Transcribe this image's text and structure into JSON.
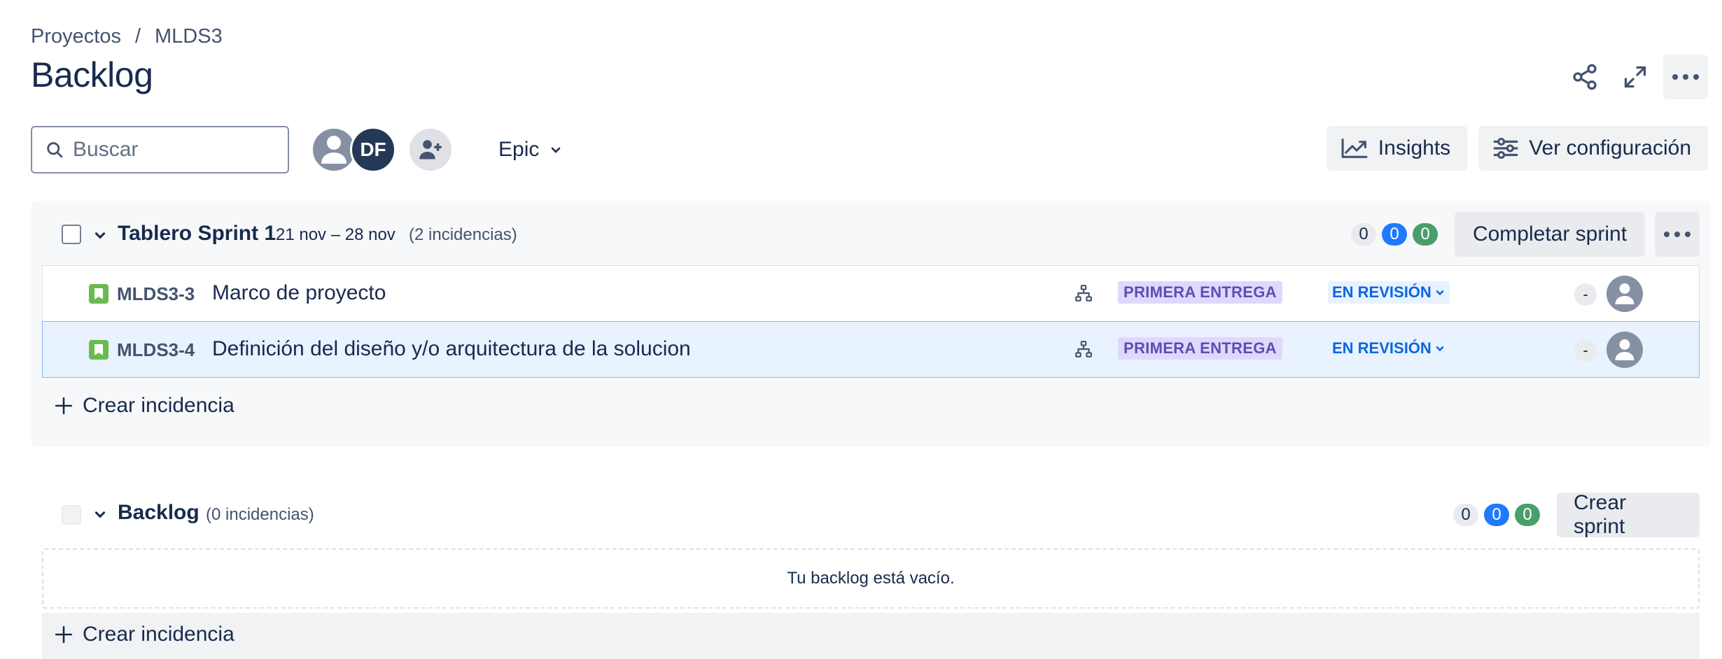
{
  "breadcrumb": {
    "items": [
      "Proyectos",
      "MLDS3"
    ],
    "separator": "/"
  },
  "page_title": "Backlog",
  "toolbar": {
    "search_placeholder": "Buscar",
    "avatar_initials": "DF",
    "epic_filter_label": "Epic",
    "insights_label": "Insights",
    "settings_label": "Ver configuración"
  },
  "sprint": {
    "name": "Tablero Sprint 1",
    "dates": "21 nov – 28 nov",
    "issue_count": "(2 incidencias)",
    "counts": {
      "todo": "0",
      "in_progress": "0",
      "done": "0"
    },
    "complete_label": "Completar sprint",
    "issues": [
      {
        "key": "MLDS3-3",
        "summary": "Marco de proyecto",
        "epic": "PRIMERA ENTREGA",
        "status": "EN REVISIÓN",
        "estimate": "-"
      },
      {
        "key": "MLDS3-4",
        "summary": "Definición del diseño y/o arquitectura de la solucion",
        "epic": "PRIMERA ENTREGA",
        "status": "EN REVISIÓN",
        "estimate": "-"
      }
    ],
    "create_issue_label": "Crear incidencia"
  },
  "backlog": {
    "name": "Backlog",
    "issue_count": "(0 incidencias)",
    "counts": {
      "todo": "0",
      "in_progress": "0",
      "done": "0"
    },
    "create_sprint_label": "Crear sprint",
    "empty_message": "Tu backlog está vacío.",
    "create_issue_label": "Crear incidencia"
  },
  "colors": {
    "accent_blue": "#1d7afc",
    "done_green": "#4a9e6b",
    "epic_purple": "#dfd8fd",
    "status_blue": "#0c66e4",
    "story_green": "#6aba50"
  },
  "icons": [
    "search-icon",
    "share-icon",
    "expand-icon",
    "more-icon",
    "add-person-icon",
    "chevron-down-icon",
    "insights-icon",
    "settings-sliders-icon",
    "story-icon",
    "hierarchy-icon",
    "plus-icon",
    "person-icon"
  ]
}
